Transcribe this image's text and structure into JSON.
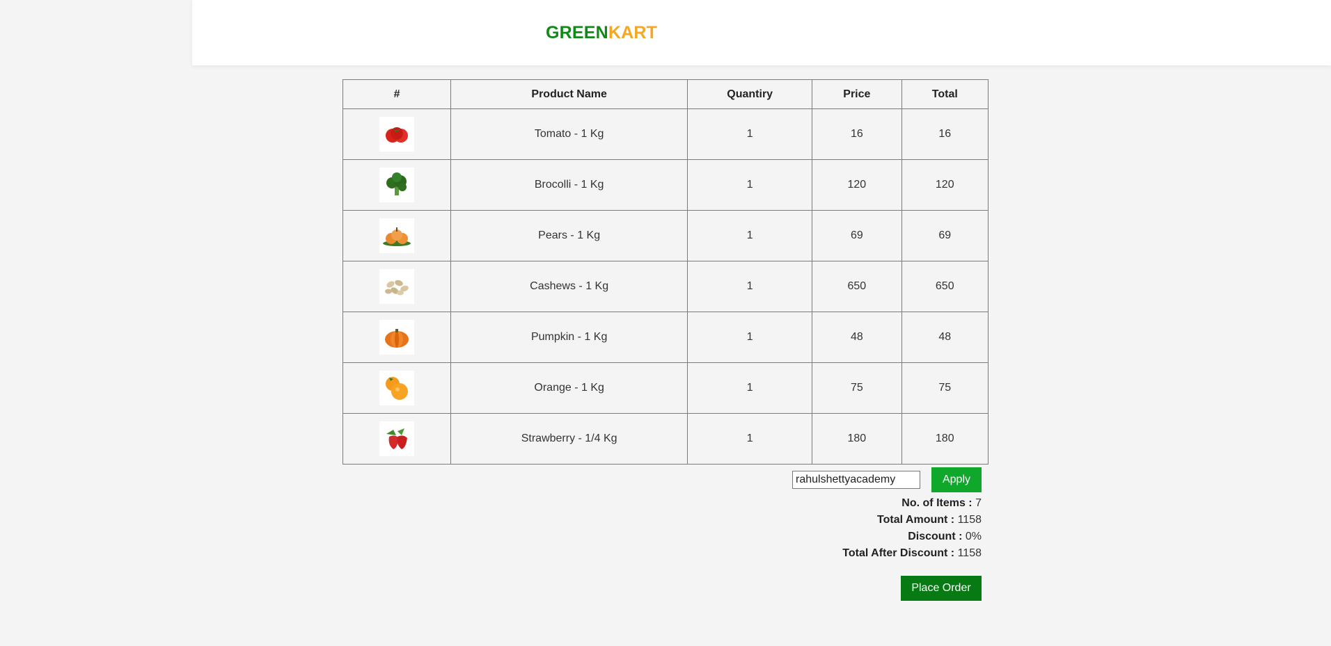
{
  "header": {
    "brand_part1": "GREEN",
    "brand_part2": "KART",
    "brand_colors": {
      "green": "#0e8a16",
      "kart": "#f5a623"
    }
  },
  "table": {
    "headers": [
      "#",
      "Product Name",
      "Quantiry",
      "Price",
      "Total"
    ],
    "rows": [
      {
        "icon": "tomato-icon",
        "name": "Tomato - 1 Kg",
        "quantity": "1",
        "price": "16",
        "total": "16"
      },
      {
        "icon": "broccoli-icon",
        "name": "Brocolli - 1 Kg",
        "quantity": "1",
        "price": "120",
        "total": "120"
      },
      {
        "icon": "pears-icon",
        "name": "Pears - 1 Kg",
        "quantity": "1",
        "price": "69",
        "total": "69"
      },
      {
        "icon": "cashews-icon",
        "name": "Cashews - 1 Kg",
        "quantity": "1",
        "price": "650",
        "total": "650"
      },
      {
        "icon": "pumpkin-icon",
        "name": "Pumpkin - 1 Kg",
        "quantity": "1",
        "price": "48",
        "total": "48"
      },
      {
        "icon": "orange-icon",
        "name": "Orange - 1 Kg",
        "quantity": "1",
        "price": "75",
        "total": "75"
      },
      {
        "icon": "strawberry-icon",
        "name": "Strawberry - 1/4 Kg",
        "quantity": "1",
        "price": "180",
        "total": "180"
      }
    ]
  },
  "promo": {
    "code_value": "rahulshettyacademy",
    "apply_label": "Apply"
  },
  "summary": {
    "items_label": "No. of Items :",
    "items_value": "7",
    "amount_label": "Total Amount :",
    "amount_value": "1158",
    "discount_label": "Discount :",
    "discount_value": "0%",
    "after_label": "Total After Discount :",
    "after_value": "1158"
  },
  "place_order_label": "Place Order"
}
